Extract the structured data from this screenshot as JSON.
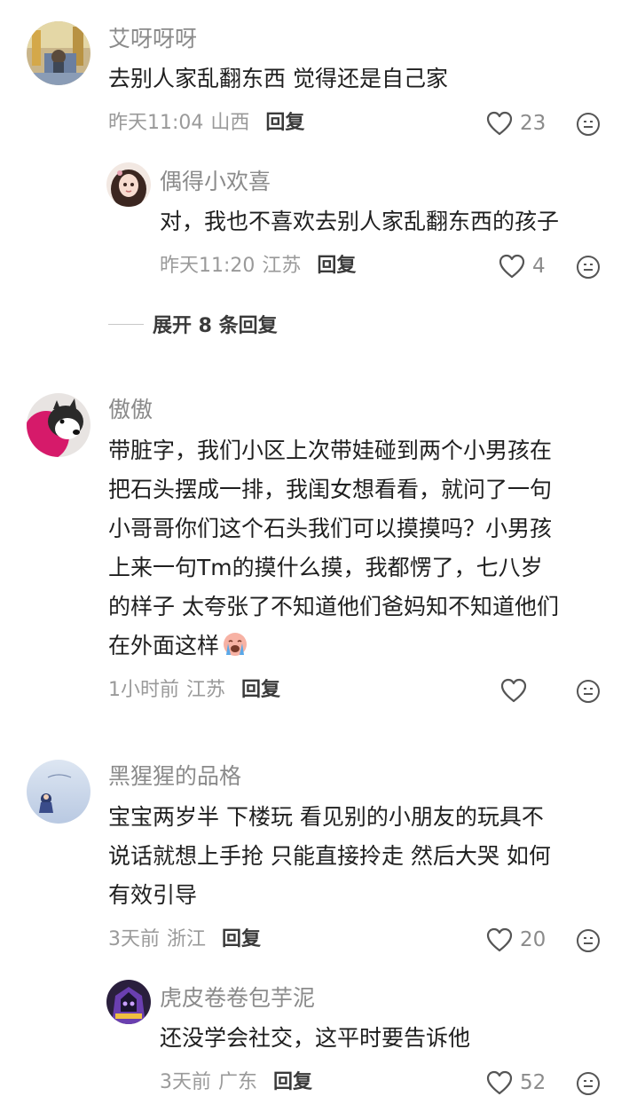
{
  "comments": [
    {
      "user": "艾呀呀呀",
      "lines": [
        "去别人家乱翻东西 觉得还是自己家"
      ],
      "time": "昨天11:04",
      "location": "山西",
      "reply_label": "回复",
      "likes": "23",
      "avatar_icon": "store-photo-avatar",
      "replies": [
        {
          "user": "偶得小欢喜",
          "lines": [
            "对，我也不喜欢去别人家乱翻东西的孩子"
          ],
          "time": "昨天11:20",
          "location": "江苏",
          "reply_label": "回复",
          "likes": "4",
          "avatar_icon": "anime-girl-avatar"
        }
      ],
      "expand_label": "展开 8 条回复"
    },
    {
      "user": "傲傲",
      "lines": [
        "带脏字，我们小区上次带娃碰到两个小男孩在",
        "把石头摆成一排，我闺女想看看，就问了一句",
        "小哥哥你们这个石头我们可以摸摸吗？小男孩",
        "上来一句Tm的摸什么摸，我都愣了，七八岁",
        "的样子 太夸张了不知道他们爸妈知不知道他们",
        "在外面这样"
      ],
      "time": "1小时前",
      "location": "江苏",
      "reply_label": "回复",
      "likes": "",
      "avatar_icon": "husky-dog-avatar",
      "inline_emoji": "crying-emoji"
    },
    {
      "user": "黑猩猩的品格",
      "lines": [
        "宝宝两岁半 下楼玩 看见别的小朋友的玩具不",
        "说话就想上手抢 只能直接拎走 然后大哭 如何",
        "有效引导"
      ],
      "time": "3天前",
      "location": "浙江",
      "reply_label": "回复",
      "likes": "20",
      "avatar_icon": "sky-figure-avatar",
      "replies": [
        {
          "user": "虎皮卷卷包芋泥",
          "lines": [
            "还没学会社交，这平时要告诉他"
          ],
          "time": "3天前",
          "location": "广东",
          "reply_label": "回复",
          "likes": "52",
          "avatar_icon": "purple-character-avatar"
        }
      ]
    }
  ],
  "icons": {
    "like": "heart-outline-icon",
    "react": "smiley-icon"
  },
  "colors": {
    "nickname": "#8b8b8b",
    "meta": "#9a9a9a",
    "reply": "#3a3a3a",
    "text": "#1f1f1f"
  }
}
